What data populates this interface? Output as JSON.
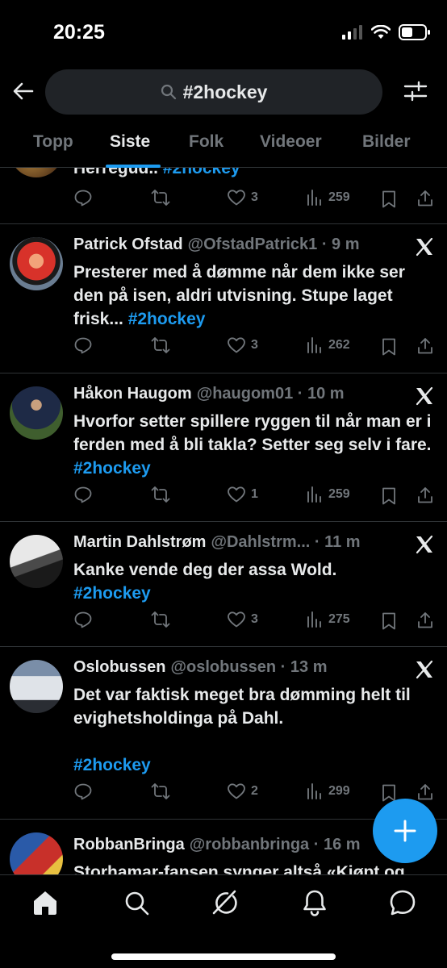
{
  "status": {
    "time": "20:25"
  },
  "search": {
    "query": "#2hockey"
  },
  "tabs": [
    {
      "label": "Topp"
    },
    {
      "label": "Siste"
    },
    {
      "label": "Folk"
    },
    {
      "label": "Videoer"
    },
    {
      "label": "Bilder"
    }
  ],
  "tweets": [
    {
      "text": "Herregud.. ",
      "hashtag": "#2hockey",
      "likes": "3",
      "views": "259"
    },
    {
      "name": "Patrick Ofstad",
      "handle_time": "@OfstadPatrick1 · 9 m",
      "text": "Presterer med å dømme når dem ikke ser den på isen, aldri utvisning. Stupe laget frisk... ",
      "hashtag": "#2hockey",
      "likes": "3",
      "views": "262"
    },
    {
      "name": "Håkon Haugom",
      "handle_time": "@haugom01 · 10 m",
      "text": "Hvorfor setter spillere ryggen til når man er i ferden med å bli takla? Setter seg selv i fare. ",
      "hashtag": "#2hockey",
      "likes": "1",
      "views": "259"
    },
    {
      "name": "Martin Dahlstrøm",
      "handle_time": "@Dahlstrm... · 11 m",
      "text": "Kanke vende deg der assa Wold.",
      "hashtag": "#2hockey",
      "likes": "3",
      "views": "275"
    },
    {
      "name": "Oslobussen",
      "handle_time": "@oslobussen · 13 m",
      "text": "Det var faktisk meget bra dømming helt til evighetsholdinga på Dahl.",
      "hashtag": "#2hockey",
      "likes": "2",
      "views": "299"
    },
    {
      "name": "RobbanBringa",
      "handle_time": "@robbanbringa · 16 m",
      "text": "Storhamar-fansen synger altså «Kjøpt og"
    }
  ],
  "colors": {
    "accent": "#1d9bf0",
    "background": "#000000",
    "muted": "#71767b",
    "text": "#e7e9ea"
  },
  "nav": [
    "home-icon",
    "search-icon",
    "grok-icon",
    "notifications-icon",
    "messages-icon"
  ]
}
